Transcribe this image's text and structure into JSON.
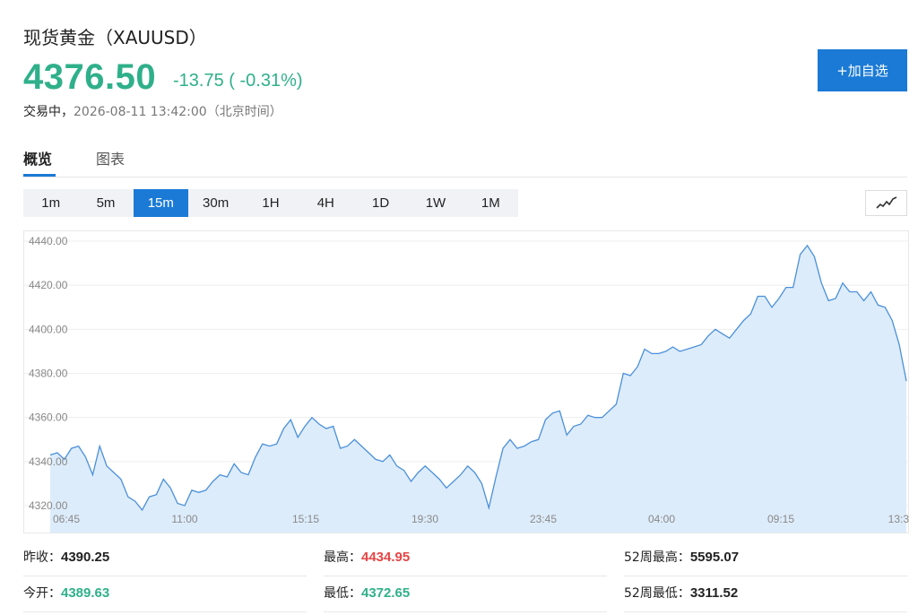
{
  "header": {
    "title": "现货黄金（XAUUSD）",
    "price": "4376.50",
    "change": "-13.75 ( -0.31%)",
    "status_label": "交易中，",
    "status_time": "2026-08-11 13:42:00（北京时间）",
    "add_button": "+加自选",
    "price_color": "#2fb08a"
  },
  "tabs": [
    {
      "label": "概览",
      "active": true
    },
    {
      "label": "图表",
      "active": false
    }
  ],
  "periods": [
    {
      "label": "1m",
      "active": false
    },
    {
      "label": "5m",
      "active": false
    },
    {
      "label": "15m",
      "active": true
    },
    {
      "label": "30m",
      "active": false
    },
    {
      "label": "1H",
      "active": false
    },
    {
      "label": "4H",
      "active": false
    },
    {
      "label": "1D",
      "active": false
    },
    {
      "label": "1W",
      "active": false
    },
    {
      "label": "1M",
      "active": false
    }
  ],
  "chart_type_icon": "line-chart-icon",
  "chart_data": {
    "type": "area",
    "title": "",
    "xlabel": "",
    "ylabel": "",
    "ylim": [
      4315,
      4442
    ],
    "y_ticks": [
      "4320.00",
      "4340.00",
      "4360.00",
      "4380.00",
      "4400.00",
      "4420.00",
      "4440.00"
    ],
    "x_ticks": [
      "06:45",
      "11:00",
      "15:15",
      "19:30",
      "23:45",
      "04:00",
      "09:15",
      "13:3"
    ],
    "grid": true,
    "line_color": "#4a90d9",
    "fill_color": "#ddecfb",
    "series": [
      {
        "values": [
          4343,
          4344,
          4341,
          4346,
          4347,
          4342,
          4334,
          4347,
          4338,
          4335,
          4332,
          4324,
          4322,
          4318,
          4324,
          4325,
          4332,
          4328,
          4321,
          4320,
          4327,
          4326,
          4327,
          4331,
          4334,
          4333,
          4339,
          4335,
          4334,
          4342,
          4348,
          4347,
          4348,
          4355,
          4359,
          4351,
          4356,
          4360,
          4357,
          4355,
          4356,
          4346,
          4347,
          4350,
          4347,
          4344,
          4341,
          4340,
          4343,
          4338,
          4336,
          4331,
          4335,
          4338,
          4335,
          4332,
          4328,
          4331,
          4334,
          4338,
          4335,
          4330,
          4319,
          4333,
          4346,
          4350,
          4346,
          4347,
          4349,
          4350,
          4359,
          4362,
          4363,
          4352,
          4356,
          4357,
          4361,
          4360,
          4360,
          4363,
          4366,
          4380,
          4379,
          4383,
          4391,
          4389,
          4389,
          4390,
          4392,
          4390,
          4391,
          4392,
          4393,
          4397,
          4400,
          4398,
          4396,
          4400,
          4404,
          4407,
          4415,
          4415,
          4410,
          4414,
          4419,
          4419,
          4434,
          4438,
          4433,
          4421,
          4413,
          4414,
          4421,
          4417,
          4417,
          4413,
          4417,
          4411,
          4410,
          4404,
          4393,
          4376.5
        ]
      }
    ]
  },
  "stats": [
    [
      {
        "label": "昨收：",
        "value": "4390.25",
        "tone": "dark"
      },
      {
        "label": "最高：",
        "value": "4434.95",
        "tone": "red"
      },
      {
        "label": "52周最高：",
        "value": "5595.07",
        "tone": "dark"
      }
    ],
    [
      {
        "label": "今开：",
        "value": "4389.63",
        "tone": "green"
      },
      {
        "label": "最低：",
        "value": "4372.65",
        "tone": "green"
      },
      {
        "label": "52周最低：",
        "value": "3311.52",
        "tone": "dark"
      }
    ]
  ]
}
